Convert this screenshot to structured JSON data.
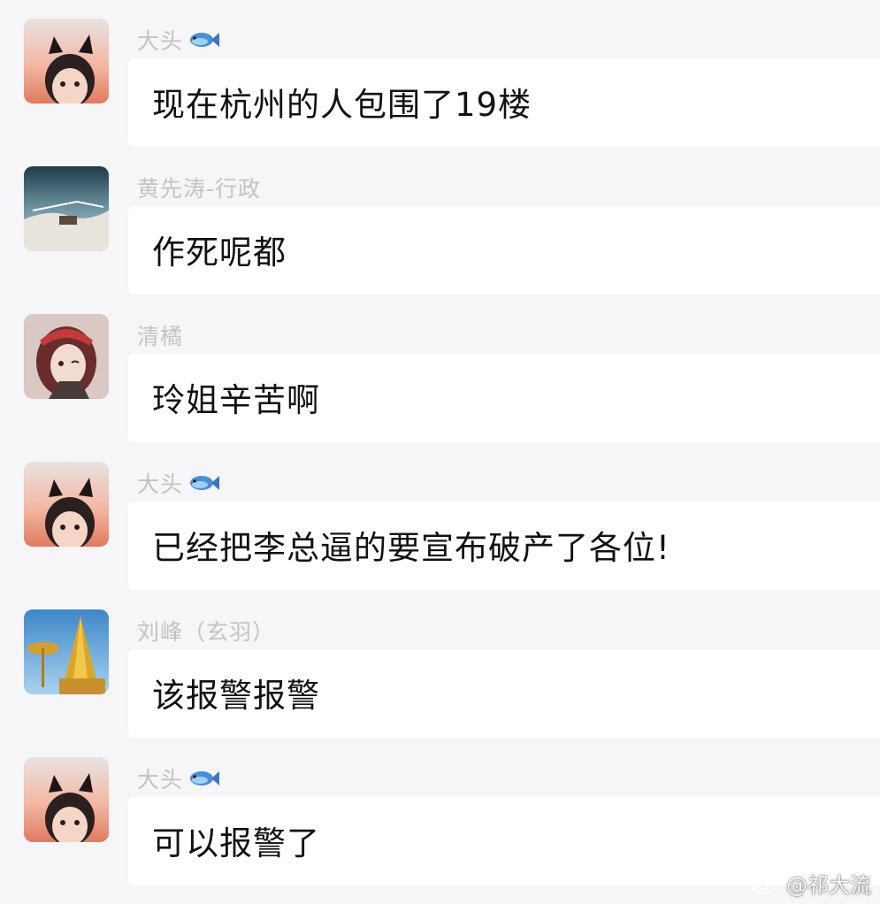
{
  "messages": [
    {
      "sender": "大头",
      "sender_icon": "fish-emoji",
      "avatar": "cat-ear-girl-avatar",
      "text": "现在杭州的人包围了19楼"
    },
    {
      "sender": "黄先涛-行政",
      "sender_icon": "",
      "avatar": "landscape-avatar",
      "text": "作死呢都"
    },
    {
      "sender": "清橘",
      "sender_icon": "",
      "avatar": "anime-girl-avatar",
      "text": "玲姐辛苦啊"
    },
    {
      "sender": "大头",
      "sender_icon": "fish-emoji",
      "avatar": "cat-ear-girl-avatar",
      "text": "已经把李总逼的要宣布破产了各位!"
    },
    {
      "sender": "刘峰（玄羽）",
      "sender_icon": "",
      "avatar": "golden-pagoda-avatar",
      "text": "该报警报警"
    },
    {
      "sender": "大头",
      "sender_icon": "fish-emoji",
      "avatar": "cat-ear-girl-avatar",
      "text": "可以报警了"
    }
  ],
  "watermark": {
    "text": "@祁大流",
    "icon": "weibo-icon"
  },
  "colors": {
    "background": "#f6f5f7",
    "bubble": "#ffffff",
    "sender_name": "#c3c3c6",
    "message_text": "#111111"
  }
}
